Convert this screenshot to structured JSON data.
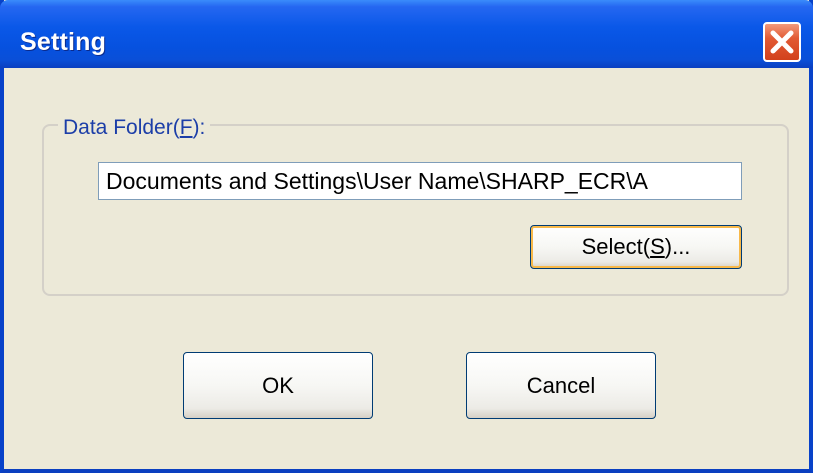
{
  "window": {
    "title": "Setting",
    "close_icon": "close-icon"
  },
  "data_folder": {
    "label_prefix": "Data Folder(",
    "label_mnemonic": "F",
    "label_suffix": "):",
    "path_value": "Documents and Settings\\User Name\\SHARP_ECR\\A",
    "select_button": {
      "prefix": "Select(",
      "mnemonic": "S",
      "suffix": ")..."
    }
  },
  "buttons": {
    "ok": "OK",
    "cancel": "Cancel"
  },
  "colors": {
    "titlebar": "#0a58e8",
    "close_button": "#d2411c",
    "dialog_background": "#ece9d8",
    "group_label_text": "#1c3ea8"
  }
}
